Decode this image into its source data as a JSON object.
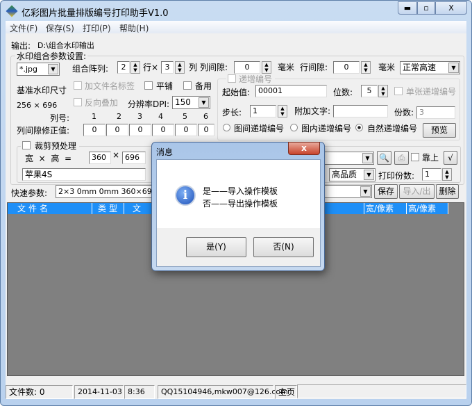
{
  "window": {
    "title": "亿彩图片批量排版编号打印助手V1.0",
    "minimize": "▬",
    "maximize": "▫",
    "close": "X"
  },
  "menu": [
    "文件(F)",
    "保存(S)",
    "打印(P)",
    "帮助(H)"
  ],
  "output": {
    "label": "输出:",
    "path": "D:\\组合水印输出"
  },
  "params": {
    "group_label": "水印组合参数设置:",
    "format": "*.jpg",
    "layout_label": "组合阵列:",
    "rows": "2",
    "rows_unit": "行×",
    "cols": "3",
    "cols_unit": "列",
    "col_gap_label": "列间隙:",
    "col_gap": "0",
    "mm1": "毫米",
    "row_gap_label": "行间隙:",
    "row_gap": "0",
    "mm2": "毫米",
    "speed": "正常高速",
    "base_size_label": "基准水印尺寸",
    "base_size": "256 × 696",
    "add_filename": "加文件名标签",
    "tile": "平铺",
    "spare": "备用",
    "reverse": "反向叠加",
    "dpi_label": "分辨率DPI:",
    "dpi": "150",
    "col_no_label": "列号:",
    "col_numbers": [
      "1",
      "2",
      "3",
      "4",
      "5",
      "6"
    ],
    "col_fix_label": "列间隙修正值:",
    "col_fix": [
      "0",
      "0",
      "0",
      "0",
      "0",
      "0"
    ]
  },
  "numbering": {
    "group_label": "递增编号",
    "start_label": "起始值:",
    "start": "00001",
    "digits_label": "位数:",
    "digits": "5",
    "single": "单张递增编号",
    "step_label": "步长:",
    "step": "1",
    "extra_label": "附加文字:",
    "extra": "",
    "copies_label": "份数:",
    "copies": "3",
    "radios": [
      "图间递增编号",
      "图内递增编号",
      "自然递增编号"
    ],
    "preview": "预览"
  },
  "crop": {
    "group_label": "裁剪预处理",
    "wh_label": "宽  ×  高  =",
    "width": "360",
    "x": "×",
    "height": "696",
    "preset": "苹果4S"
  },
  "print": {
    "top_label": "靠上",
    "check": "√",
    "quality": "高品质",
    "copies_label": "打印份数:",
    "copies": "1"
  },
  "quick": {
    "label": "快速参数:",
    "value": "2×3 0mm 0mm 360×696",
    "save": "保存",
    "import_export": "导入/出",
    "delete": "删除"
  },
  "table": {
    "columns": [
      "文件名",
      "类型",
      "文",
      "宽/像素",
      "高/像素"
    ]
  },
  "status": {
    "files": "文件数: 0",
    "date": "2014-11-03",
    "time": "8:36",
    "contact": "QQ15104946,mkw007@126.com",
    "home": "主页"
  },
  "dialog": {
    "title": "消息",
    "close": "x",
    "line1": "是——导入操作模板",
    "line2": "否——导出操作模板",
    "yes": "是(Y)",
    "no": "否(N)"
  }
}
